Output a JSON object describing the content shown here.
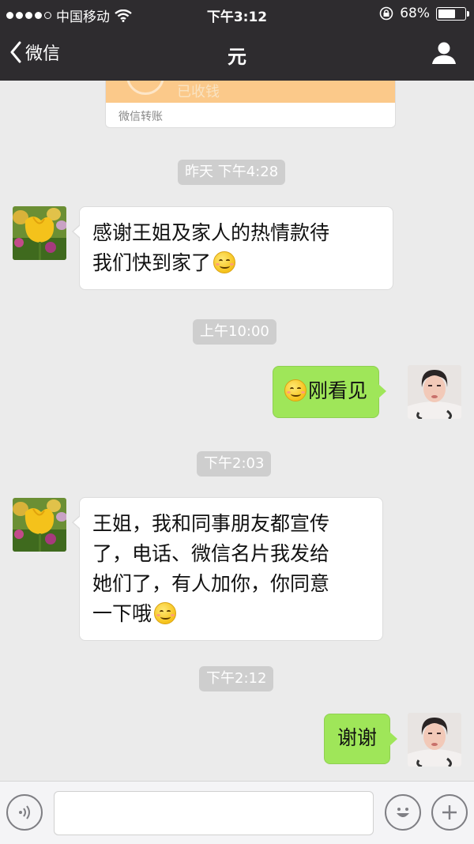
{
  "status_bar": {
    "carrier": "中国移动",
    "time": "下午3:12",
    "battery": "68%",
    "battery_level": 0.68
  },
  "navbar": {
    "back_label": "微信",
    "title": "元"
  },
  "transfer_card": {
    "faded_text": "已收钱",
    "footer": "微信转账"
  },
  "messages": [
    {
      "type": "time",
      "text": "昨天 下午4:28"
    },
    {
      "type": "incoming",
      "lines": [
        "感谢王姐及家人的热情款待",
        "我们快到家了"
      ],
      "trailing_emoji": "smile-emoji"
    },
    {
      "type": "time",
      "text": "上午10:00"
    },
    {
      "type": "outgoing",
      "text": "刚看见",
      "leading_emoji": "smile-emoji"
    },
    {
      "type": "time",
      "text": "下午2:03"
    },
    {
      "type": "incoming",
      "lines": [
        "王姐，我和同事朋友都宣传",
        "了，电话、微信名片我发给",
        "她们了，有人加你，你同意",
        "一下哦"
      ],
      "trailing_emoji": "smile-emoji"
    },
    {
      "type": "time",
      "text": "下午2:12"
    },
    {
      "type": "outgoing",
      "text": "谢谢"
    }
  ],
  "input_bar": {
    "left_icon": "voice-icon",
    "emoji_icon": "emoji-icon",
    "more_icon": "plus-icon",
    "placeholder": ""
  },
  "colors": {
    "topbar": "#2e2c2f",
    "background": "#ebebeb",
    "outgoing_bubble": "#9fe659",
    "incoming_bubble": "#ffffff",
    "transfer_orange": "#fbc98a",
    "timestamp_bg": "#cecece"
  }
}
